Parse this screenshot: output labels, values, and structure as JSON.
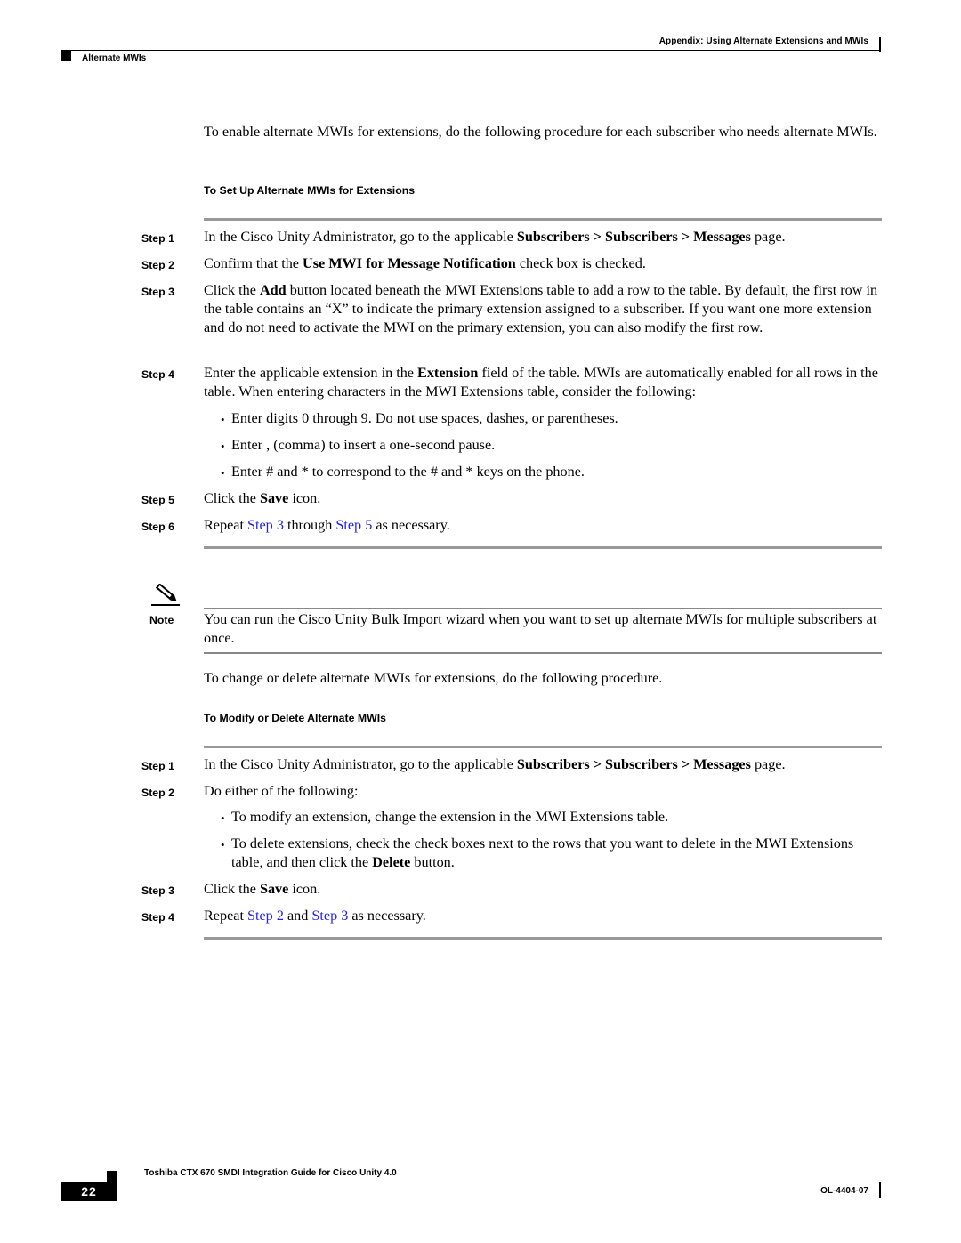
{
  "header": {
    "chapter": "Appendix: Using Alternate Extensions and MWIs",
    "section": "Alternate MWIs"
  },
  "intro": "To enable alternate MWIs for extensions, do the following procedure for each subscriber who needs alternate MWIs.",
  "procedure1": {
    "title": "To Set Up Alternate MWIs for Extensions",
    "steps": [
      {
        "label": "Step 1",
        "pre": "In the Cisco Unity Administrator, go to the applicable ",
        "bold": "Subscribers > Subscribers > Messages",
        "post": " page."
      },
      {
        "label": "Step 2",
        "pre": "Confirm that the ",
        "bold": "Use MWI for Message Notification",
        "post": " check box is checked."
      },
      {
        "label": "Step 3",
        "pre": "Click the ",
        "bold": "Add",
        "post": " button located beneath the MWI Extensions table to add a row to the table. By default, the first row in the table contains an “X” to indicate the primary extension assigned to a subscriber. If you want one more extension and do not need to activate the MWI on the primary extension, you can also modify the first row."
      },
      {
        "label": "Step 4",
        "pre": "Enter the applicable extension in the ",
        "bold": "Extension",
        "post": " field of the table. MWIs are automatically enabled for all rows in the table. When entering characters in the MWI Extensions table, consider the following:"
      },
      {
        "label": "Step 5",
        "pre": "Click the ",
        "bold": "Save",
        "post": " icon."
      },
      {
        "label": "Step 6",
        "pre": "Repeat ",
        "link1": "Step 3",
        "mid": " through ",
        "link2": "Step 5",
        "post": " as necessary."
      }
    ],
    "bullets": [
      "Enter digits 0 through 9. Do not use spaces, dashes, or parentheses.",
      "Enter , (comma) to insert a one-second pause.",
      "Enter # and * to correspond to the # and * keys on the phone."
    ]
  },
  "note": {
    "label": "Note",
    "icon": "pencil-icon",
    "text": "You can run the Cisco Unity Bulk Import wizard when you want to set up alternate MWIs for multiple subscribers at once."
  },
  "intro2": "To change or delete alternate MWIs for extensions, do the following procedure.",
  "procedure2": {
    "title": "To Modify or Delete Alternate MWIs",
    "steps": [
      {
        "label": "Step 1",
        "pre": "In the Cisco Unity Administrator, go to the applicable ",
        "bold": "Subscribers > Subscribers > Messages",
        "post": " page."
      },
      {
        "label": "Step 2",
        "pre": "Do either of the following:"
      },
      {
        "label": "Step 3",
        "pre": "Click the ",
        "bold": "Save",
        "post": " icon."
      },
      {
        "label": "Step 4",
        "pre": "Repeat ",
        "link1": "Step 2",
        "mid": " and ",
        "link2": "Step 3",
        "post": " as necessary."
      }
    ],
    "bullets": [
      {
        "pre": "To modify an extension, change the extension in the MWI Extensions table."
      },
      {
        "pre": "To delete extensions, check the check boxes next to the rows that you want to delete in the MWI Extensions table, and then click the ",
        "bold": "Delete",
        "post": " button."
      }
    ],
    "bullet_char": "•"
  },
  "footer": {
    "title": "Toshiba CTX 670 SMDI Integration Guide for Cisco Unity 4.0",
    "page_number": "22",
    "doc_number": "OL-4404-07"
  }
}
